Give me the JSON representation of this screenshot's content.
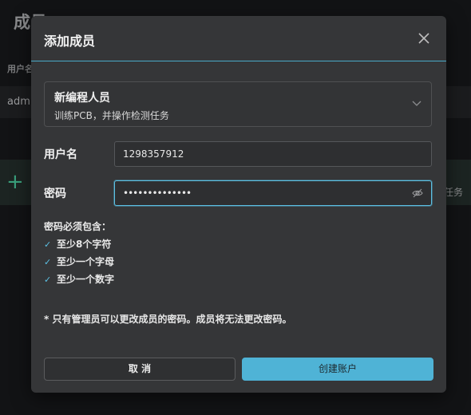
{
  "background": {
    "page_title": "成员",
    "column_header": "用户名",
    "row_text": "admi",
    "right_text": "任务",
    "plus": "+"
  },
  "modal": {
    "title": "添加成员",
    "role": {
      "name": "新编程人员",
      "description": "训练PCB，并操作检测任务"
    },
    "username": {
      "label": "用户名",
      "value": "1298357912"
    },
    "password": {
      "label": "密码",
      "value": "••••••••••••••"
    },
    "requirements": {
      "title": "密码必须包含：",
      "items": [
        "至少8个字符",
        "至少一个字母",
        "至少一个数字"
      ]
    },
    "note": "* 只有管理员可以更改成员的密码。成员将无法更改密码。",
    "cancel_label": "取 消",
    "create_label": "创建账户"
  },
  "colors": {
    "accent": "#4fb3d6",
    "modal_bg": "#353638",
    "page_bg": "#121315"
  }
}
